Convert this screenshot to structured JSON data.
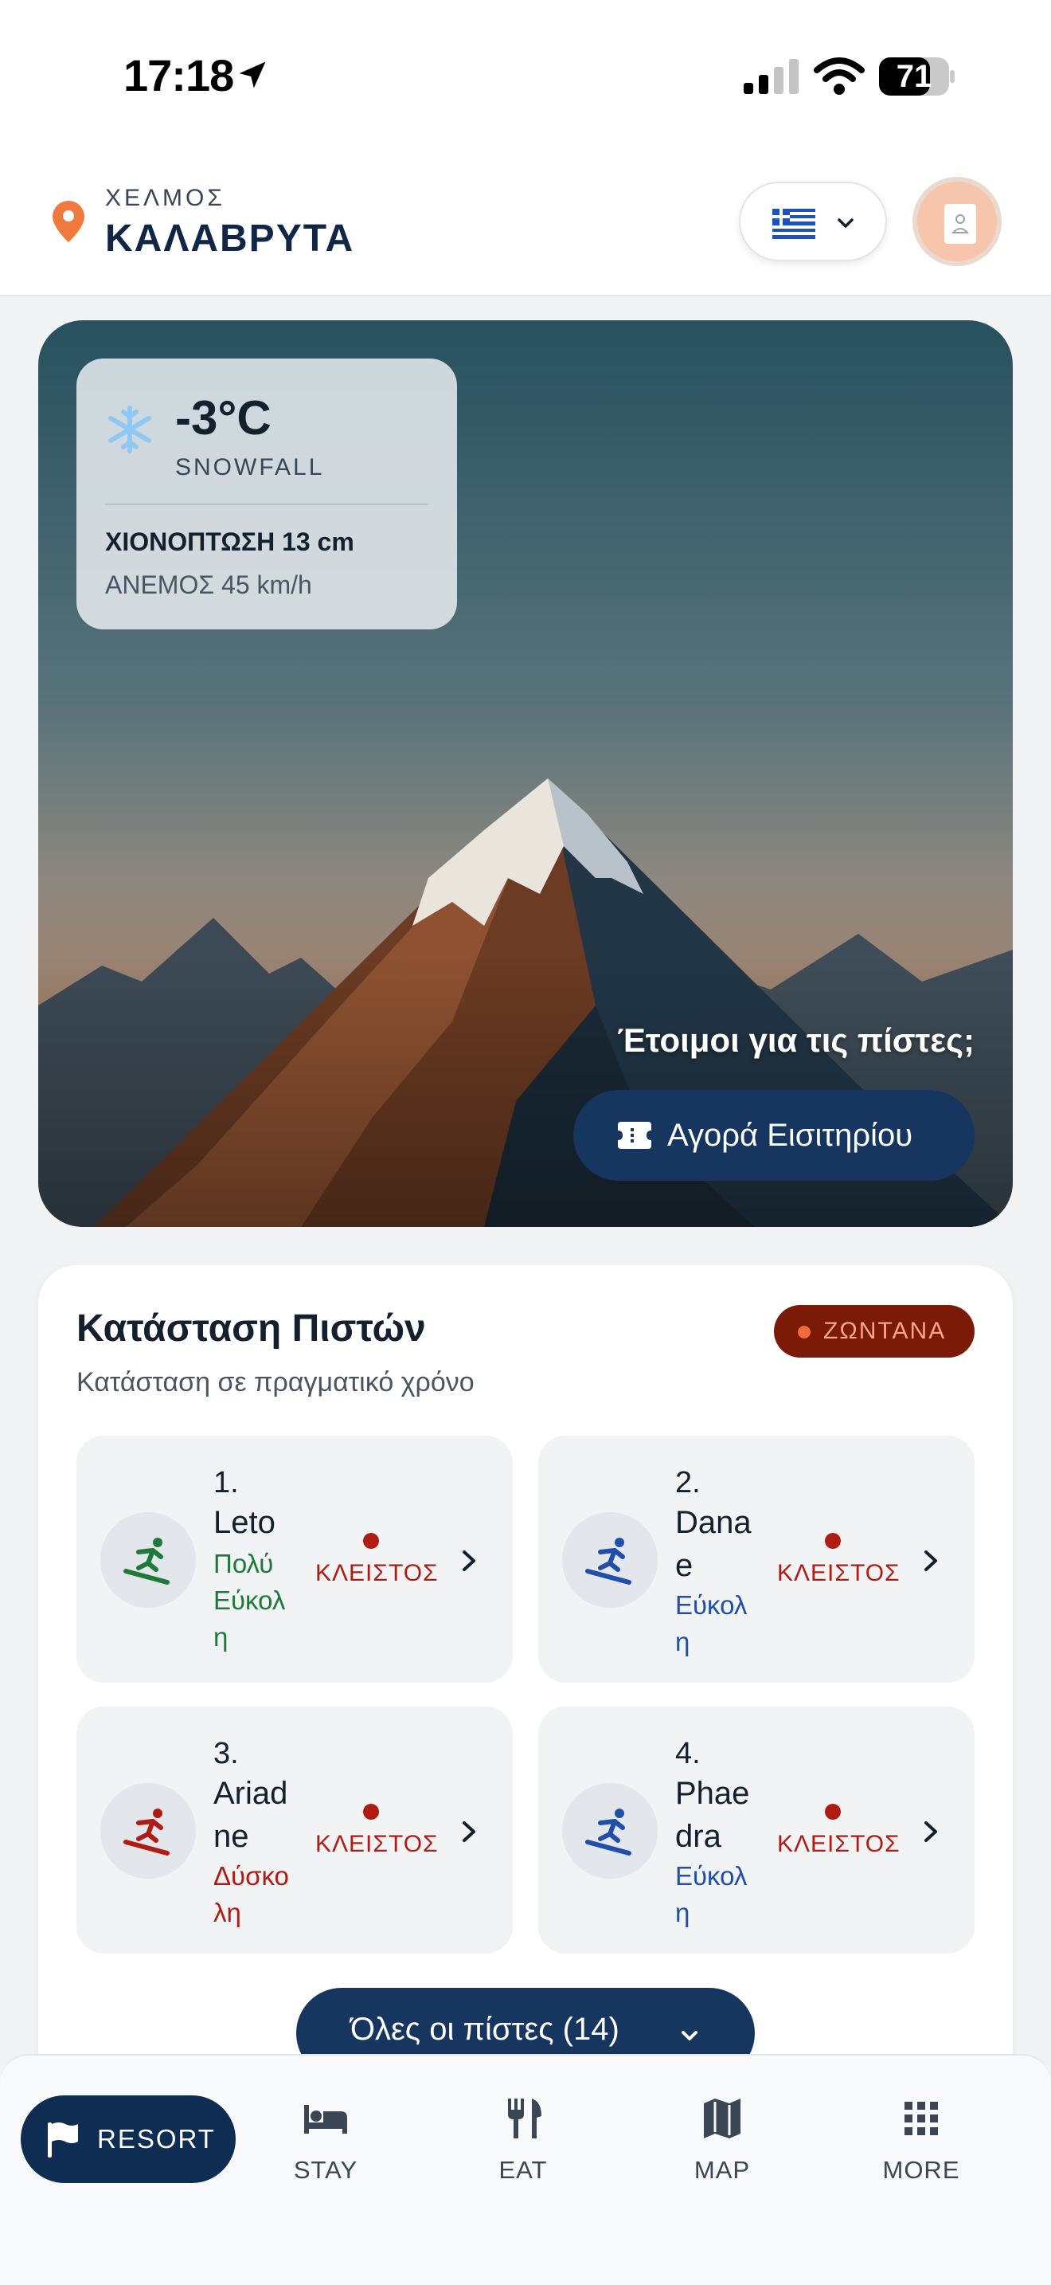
{
  "status_bar": {
    "time": "17:18",
    "battery": "71"
  },
  "header": {
    "region": "ΧΕΛΜΟΣ",
    "town": "ΚΑΛΑΒΡΥΤΑ"
  },
  "weather": {
    "temperature": "-3°C",
    "condition": "SNOWFALL",
    "snowfall": "ΧΙΟΝΟΠΤΩΣΗ 13 cm",
    "wind": "ΑΝΕΜΟΣ 45 km/h"
  },
  "hero": {
    "prompt": "Έτοιμοι για τις πίστες;",
    "ticket_button": "Αγορά Εισιτηρίου"
  },
  "slopes": {
    "title": "Κατάσταση Πιστών",
    "subtitle": "Κατάσταση σε πραγματικό χρόνο",
    "live_label": "ΖΩΝΤΑΝΑ",
    "items": [
      {
        "number": "1.",
        "name": "Leto",
        "difficulty": "Πολύ Εύκολη",
        "status": "ΚΛΕΙΣΤΟΣ",
        "color": "#1f7a3a"
      },
      {
        "number": "2.",
        "name": "Danae",
        "difficulty": "Εύκολη",
        "status": "ΚΛΕΙΣΤΟΣ",
        "color": "#1f4fa8"
      },
      {
        "number": "3.",
        "name": "Ariadne",
        "difficulty": "Δύσκολη",
        "status": "ΚΛΕΙΣΤΟΣ",
        "color": "#b01c14"
      },
      {
        "number": "4.",
        "name": "Phaedra",
        "difficulty": "Εύκολη",
        "status": "ΚΛΕΙΣΤΟΣ",
        "color": "#1f4fa8"
      }
    ],
    "all_button": "Όλες οι πίστες (14)"
  },
  "nav": {
    "resort": "RESORT",
    "stay": "STAY",
    "eat": "EAT",
    "map": "MAP",
    "more": "MORE"
  },
  "colors": {
    "primary": "#0f2d52",
    "accent": "#f07a3e",
    "closed": "#b01c14"
  },
  "icons": [
    "location-arrow-icon",
    "signal-icon",
    "wifi-icon",
    "battery-icon",
    "map-pin-icon",
    "greek-flag-icon",
    "chevron-down-icon",
    "avatar-icon",
    "snowflake-icon",
    "ticket-icon",
    "skier-icon",
    "chevron-right-icon",
    "flag-icon",
    "bed-icon",
    "utensils-icon",
    "map-icon",
    "grid-icon"
  ]
}
